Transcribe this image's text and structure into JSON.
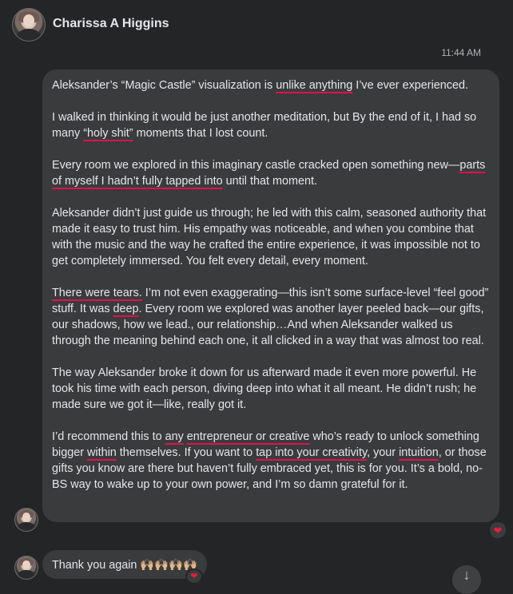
{
  "header": {
    "name": "Charissa A Higgins"
  },
  "message": {
    "time": "11:44 AM",
    "paragraphs": [
      [
        {
          "t": "Aleksander’s “Magic Castle” visualization is ",
          "u": false
        },
        {
          "t": "unlike anything",
          "u": true
        },
        {
          "t": " I’ve ever experienced.",
          "u": false
        }
      ],
      [
        {
          "t": "I walked in thinking it would be just another meditation, but By the end of it, I had so many ",
          "u": false
        },
        {
          "t": "“holy shit”",
          "u": true
        },
        {
          "t": " moments that I lost count.",
          "u": false
        }
      ],
      [
        {
          "t": "Every room we explored in this imaginary castle cracked open something new—",
          "u": false
        },
        {
          "t": "parts of myself I hadn’t fully tapped into",
          "u": true
        },
        {
          "t": " until that moment.",
          "u": false
        }
      ],
      [
        {
          "t": "Aleksander didn’t just guide us through; he led with this calm, seasoned authority that made it easy to trust him. His empathy was noticeable, and when you combine that with the music and the way he crafted the entire experience, it was impossible not to get completely immersed. You felt every detail, every moment.",
          "u": false
        }
      ],
      [
        {
          "t": "There were tears.",
          "u": true
        },
        {
          "t": " I’m not even exaggerating—this isn’t some surface-level “feel good” stuff. It was ",
          "u": false
        },
        {
          "t": "deep",
          "u": true
        },
        {
          "t": ". Every room we explored was another layer peeled back—our gifts, our shadows, how we lead., our relationship…And when Aleksander walked us through the meaning behind each one, it all clicked in a way that was almost too real.",
          "u": false
        }
      ],
      [
        {
          "t": "The way Aleksander broke it down for us afterward made it even more powerful. He took his time with each person, diving deep into what it all meant. He didn’t rush; he made sure we got it—like, really got it.",
          "u": false
        }
      ],
      [
        {
          "t": "I’d recommend this to ",
          "u": false
        },
        {
          "t": "any",
          "u": true
        },
        {
          "t": " ",
          "u": false
        },
        {
          "t": "entrepreneur or creative",
          "u": true
        },
        {
          "t": " who’s ready to unlock something bigger ",
          "u": false
        },
        {
          "t": "within",
          "u": true
        },
        {
          "t": " themselves. If you want to ",
          "u": false
        },
        {
          "t": "tap into your creativity",
          "u": true
        },
        {
          "t": ", your ",
          "u": false
        },
        {
          "t": "intuition",
          "u": true
        },
        {
          "t": ", or those gifts you know are there but haven’t fully embraced yet, this is for you. It’s a bold, no-BS way to wake up to your own power, and I’m so damn grateful for it.",
          "u": false
        }
      ]
    ],
    "reaction": "❤"
  },
  "second_message": {
    "text": "Thank you again 🙌🏼🙌🏼🙌🏼🙌🏼",
    "reaction": "❤"
  },
  "colors": {
    "underline": "#e0114f",
    "bubble": "#3a3b3c",
    "background": "#242526"
  },
  "icons": {
    "scroll_down": "arrow-down-icon"
  }
}
